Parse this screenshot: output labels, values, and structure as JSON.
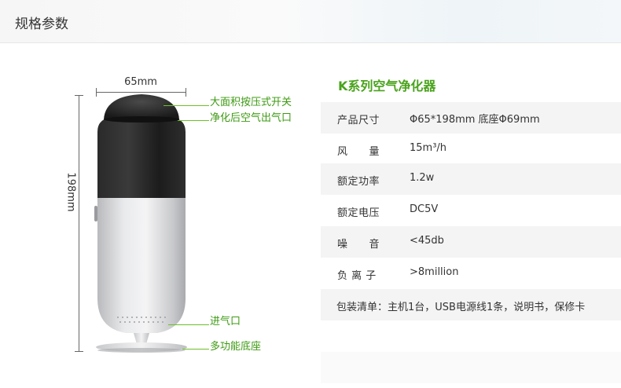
{
  "header": {
    "title": "规格参数"
  },
  "product": {
    "width_label": "65mm",
    "height_label": "198mm",
    "callouts": {
      "top_switch": "大面积按压式开关",
      "air_outlet": "净化后空气出气口",
      "air_inlet": "进气口",
      "base": "多功能底座"
    }
  },
  "spec": {
    "title": "K系列空气净化器",
    "rows": [
      {
        "key": "产品尺寸",
        "value": "Φ65*198mm  底座Φ69mm"
      },
      {
        "key": "风　　量",
        "value": "15m³/h"
      },
      {
        "key": "额定功率",
        "value": "1.2w"
      },
      {
        "key": "额定电压",
        "value": "DC5V"
      },
      {
        "key": "噪　　音",
        "value": "<45db"
      },
      {
        "key": "负 离 子",
        "value": ">8million"
      }
    ],
    "package": "包装清单：主机1台，USB电源线1条，说明书，保修卡"
  },
  "colors": {
    "accent_green": "#4aa31c",
    "callout_green": "#3d9a12",
    "body_black": "#1f1f1f",
    "body_silver": "#d9dadc"
  }
}
